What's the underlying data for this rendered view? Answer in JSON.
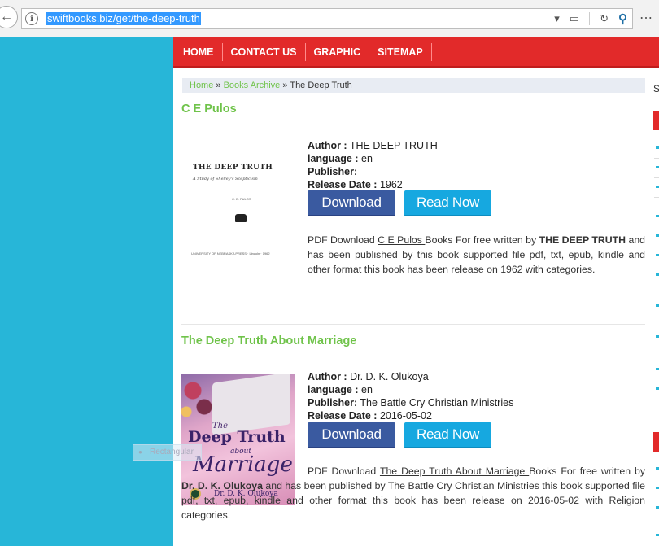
{
  "browser": {
    "url": "swiftbooks.biz/get/the-deep-truth",
    "back_icon": "←",
    "info_icon": "i",
    "dropdown_icon": "▾",
    "reader_icon": "▭",
    "reload_icon": "↻",
    "search_icon": "⚲",
    "more_icon": "⋯"
  },
  "nav": {
    "items": [
      "HOME",
      "CONTACT US",
      "GRAPHIC",
      "SITEMAP"
    ]
  },
  "breadcrumb": {
    "home": "Home",
    "sep1": "»",
    "archive": "Books Archive",
    "sep2": "»",
    "current": "The Deep Truth"
  },
  "sidebar": {
    "letter": "S"
  },
  "books": [
    {
      "title": "C E Pulos",
      "author_label": "Author :",
      "author": "THE DEEP TRUTH",
      "language_label": "language :",
      "language": "en",
      "publisher_label": "Publisher:",
      "publisher": "",
      "release_label": "Release Date :",
      "release": "1962",
      "download_label": "Download",
      "read_label": "Read Now",
      "cover": {
        "title": "THE DEEP TRUTH",
        "subtitle": "A Study of Shelley's Scepticism",
        "author": "C. E. PULOS",
        "press": "UNIVERSITY OF NEBRASKA PRESS · Lincoln · 1962"
      },
      "desc_pre": "PDF Download ",
      "desc_link": "C E Pulos ",
      "desc_mid": "Books For free written by ",
      "desc_author": "THE DEEP TRUTH",
      "desc_post": " and has been published by this book supported file pdf, txt, epub, kindle and other format this book has been release on 1962 with categories."
    },
    {
      "title": "The Deep Truth About Marriage",
      "author_label": "Author :",
      "author": "Dr. D. K. Olukoya",
      "language_label": "language :",
      "language": "en",
      "publisher_label": "Publisher:",
      "publisher": "The Battle Cry Christian Ministries",
      "release_label": "Release Date :",
      "release": "2016-05-02",
      "download_label": "Download",
      "read_label": "Read Now",
      "cover": {
        "the": "The",
        "deep": "Deep Truth",
        "about": "about",
        "marriage": "Marriage",
        "author": "Dr. D. K. Olukoya"
      },
      "desc_pre": "PDF Download ",
      "desc_link": "The Deep Truth About Marriage ",
      "desc_mid": "Books For free written by ",
      "desc_author": "Dr. D. K. Olukoya",
      "desc_post": " and has been published by The Battle Cry Christian Ministries this book supported file pdf, txt, epub, kindle and other format this book has been release on 2016-05-02 with Religion categories."
    }
  ],
  "ghost_overlay": "Rectangular"
}
